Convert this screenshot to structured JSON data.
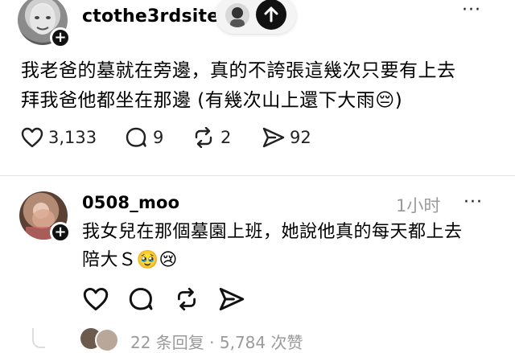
{
  "post": {
    "username": "ctothe3rdsite",
    "text_line1": "我老爸的墓就在旁邊，真的不誇張這幾次只要有上去",
    "text_line2": "拜我爸他都坐在那邊 (有幾次山上還下大雨",
    "text_line2_emoji": "😔",
    "text_line2_end": ")",
    "likes": "3,133",
    "comments": "9",
    "reposts": "2",
    "shares": "92"
  },
  "reply": {
    "username": "0508_moo",
    "time": "1小时",
    "text_line1": "我女兒在那個墓園上班，她說他真的每天都上去",
    "text_line2": "陪大Ｓ",
    "emoji1": "🥹",
    "emoji2": "😢",
    "footer": "22 条回复 · 5,784 次赞"
  },
  "icons": [
    "heart-icon",
    "comment-icon",
    "repost-icon",
    "share-icon",
    "more-icon",
    "follow-plus-icon",
    "scroll-top-arrow-icon"
  ],
  "colors": {
    "text": "#000000",
    "secondary": "#999999",
    "background": "#ffffff"
  }
}
